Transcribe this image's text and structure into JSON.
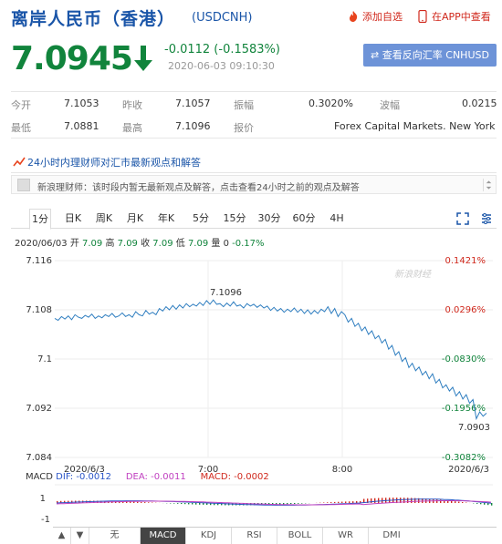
{
  "header": {
    "title": "离岸人民币（香港）",
    "ticker": "(USDCNH)",
    "add_watch": "添加自选",
    "app_view": "在APP中查看"
  },
  "quote": {
    "price": "7.0945",
    "change": "-0.0112 (-0.1583%)",
    "timestamp": "2020-06-03 09:10:30",
    "reverse_btn": "查看反向汇率 CNHUSD",
    "trend_color": "#11843c"
  },
  "stats": {
    "open_label": "今开",
    "open_val": "7.1053",
    "prev_label": "昨收",
    "prev_val": "7.1057",
    "amp_label": "振幅",
    "amp_val": "0.3020%",
    "wave_label": "波幅",
    "wave_val": "0.0215",
    "low_label": "最低",
    "low_val": "7.0881",
    "high_label": "最高",
    "high_val": "7.1096",
    "source_label": "报价",
    "source_val": "Forex Capital Markets. New York"
  },
  "news": {
    "heading": "24小时内理财师对汇市最新观点和解答",
    "message": "新浪理财师：该时段内暂无最新观点及解答，点击查看24小时之前的观点及解答"
  },
  "tabs": [
    "1分",
    "日K",
    "周K",
    "月K",
    "年K",
    "5分",
    "15分",
    "30分",
    "60分",
    "4H"
  ],
  "quote_line": {
    "date": "2020/06/03",
    "open_label": "开",
    "open": "7.09",
    "high_label": "高",
    "high": "7.09",
    "close_label": "收",
    "close": "7.09",
    "low_label": "低",
    "low": "7.09",
    "vol_label": "量",
    "vol": "0",
    "pct": "-0.17%"
  },
  "chart_data": {
    "type": "line",
    "y_ticks": [
      "7.116",
      "7.108",
      "7.1",
      "7.092",
      "7.084"
    ],
    "y_values": [
      7.116,
      7.108,
      7.1,
      7.092,
      7.084
    ],
    "pct_ticks": [
      "0.1421%",
      "0.0296%",
      "-0.0830%",
      "-0.1956%",
      "-0.3082%"
    ],
    "x_ticks": [
      "2020/6/3",
      "7:00",
      "8:00",
      "2020/6/3"
    ],
    "annotations": {
      "high": "7.1096",
      "low": "7.0903"
    },
    "watermark": "新浪财经",
    "ylim": [
      7.084,
      7.116
    ],
    "series_color": "#2f7ec0",
    "values": [
      7.1066,
      7.1063,
      7.1069,
      7.1065,
      7.107,
      7.1064,
      7.1072,
      7.1068,
      7.1066,
      7.1071,
      7.1068,
      7.1073,
      7.1066,
      7.107,
      7.1067,
      7.1072,
      7.1069,
      7.1074,
      7.1068,
      7.107,
      7.1075,
      7.1069,
      7.1072,
      7.1068,
      7.1077,
      7.1072,
      7.107,
      7.1079,
      7.1073,
      7.1076,
      7.1072,
      7.1082,
      7.1078,
      7.1085,
      7.108,
      7.1087,
      7.1081,
      7.1088,
      7.1083,
      7.109,
      7.1085,
      7.1089,
      7.1086,
      7.1092,
      7.1087,
      7.1095,
      7.1089,
      7.1096,
      7.1089,
      7.109,
      7.1085,
      7.1091,
      7.1086,
      7.1093,
      7.1086,
      7.1088,
      7.1083,
      7.109,
      7.1086,
      7.1089,
      7.1084,
      7.1088,
      7.1083,
      7.1086,
      7.1079,
      7.1084,
      7.1078,
      7.1082,
      7.1076,
      7.1081,
      7.1077,
      7.1083,
      7.1076,
      7.1081,
      7.1074,
      7.108,
      7.1073,
      7.1079,
      7.1074,
      7.1081,
      7.1077,
      7.1085,
      7.1074,
      7.1082,
      7.1069,
      7.1077,
      7.1072,
      7.106,
      7.1066,
      7.1053,
      7.1058,
      7.1046,
      7.1052,
      7.104,
      7.1046,
      7.1033,
      7.1038,
      7.1026,
      7.1032,
      7.1016,
      7.1022,
      7.1006,
      7.1012,
      7.0996,
      7.1002,
      7.0986,
      7.0993,
      7.0981,
      7.0987,
      7.0974,
      7.098,
      7.0968,
      7.0976,
      7.0961,
      7.0967,
      7.0953,
      7.0958,
      7.0948,
      7.0954,
      7.094,
      7.0947,
      7.0935,
      7.0942,
      7.0928,
      7.0934,
      7.0903,
      7.0914,
      7.0907,
      7.0912
    ]
  },
  "macd": {
    "label": "MACD",
    "dif": "DIF: -0.0012",
    "dea": "DEA: -0.0011",
    "macd": "MACD: -0.0002",
    "y_ticks": [
      "1",
      "-1"
    ]
  },
  "bottom_bar": {
    "items": [
      "无",
      "MACD",
      "KDJ",
      "RSI",
      "BOLL",
      "WR",
      "DMI"
    ],
    "active": "MACD"
  }
}
